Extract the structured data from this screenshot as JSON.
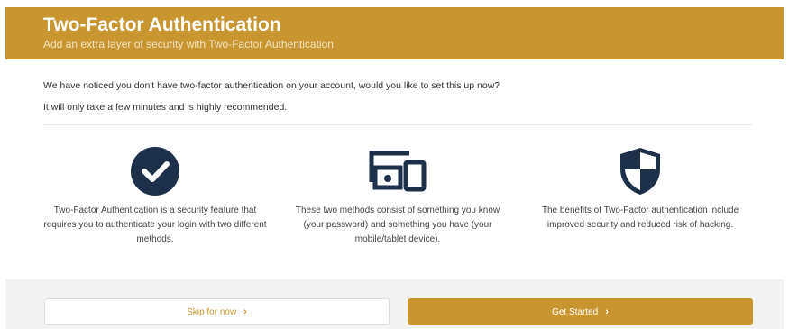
{
  "header": {
    "title": "Two-Factor Authentication",
    "subtitle": "Add an extra layer of security with Two-Factor Authentication",
    "background_color": "#c9952f"
  },
  "intro": {
    "line1": "We have noticed you don't have two-factor authentication on your account, would you like to set this up now?",
    "line2": "It will only take a few minutes and is highly recommended."
  },
  "features": [
    {
      "icon": "check-circle-icon",
      "text": "Two-Factor Authentication is a security feature that requires you to authenticate your login with two different methods."
    },
    {
      "icon": "devices-icon",
      "text": "These two methods consist of something you know (your password) and something you have (your mobile/tablet device)."
    },
    {
      "icon": "shield-icon",
      "text": "The benefits of Two-Factor authentication include improved security and reduced risk of hacking."
    }
  ],
  "actions": {
    "skip_label": "Skip for now",
    "start_label": "Get Started",
    "chevron_icon": "chevron-right-icon"
  },
  "colors": {
    "accent": "#c9952f",
    "icon_dark": "#1e3049"
  }
}
